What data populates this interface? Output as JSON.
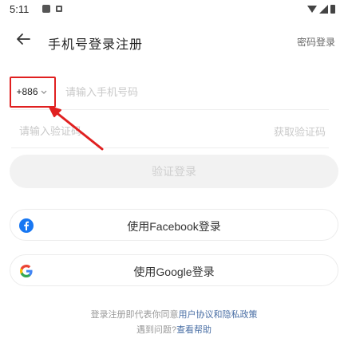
{
  "status_bar": {
    "time": "5:11",
    "icons": [
      "notification-icon",
      "notification-icon",
      "wifi-icon",
      "signal-icon",
      "battery-icon"
    ]
  },
  "app_bar": {
    "back_icon": "arrow-left-icon",
    "title": "手机号登录注册",
    "password_login_label": "密码登录"
  },
  "phone": {
    "country_code": "+886",
    "placeholder": "请输入手机号码"
  },
  "code": {
    "placeholder": "请输入验证码",
    "get_code_label": "获取验证码"
  },
  "verify_login_label": "验证登录",
  "social": {
    "facebook_label": "使用Facebook登录",
    "google_label": "使用Google登录"
  },
  "footer": {
    "agreement_prefix": "登录注册即代表你同意",
    "agreement_link": "用户协议和隐私政策",
    "help_prefix": "遇到问题?",
    "help_link": "查看帮助"
  },
  "colors": {
    "highlight": "#e02020",
    "link": "#4a6fa5",
    "facebook": "#1877f2"
  }
}
